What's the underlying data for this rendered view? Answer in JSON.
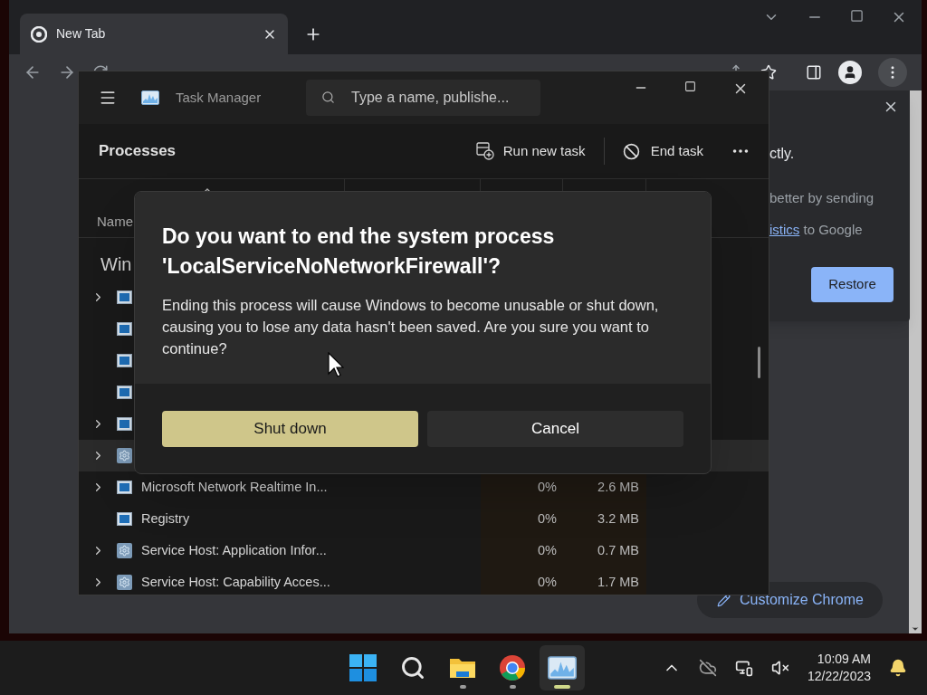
{
  "browser": {
    "tab": {
      "title": "New Tab"
    },
    "popup": {
      "line_1": "ctly.",
      "line_2": "better by sending",
      "link": "istics",
      "line_3_rest": " to Google",
      "restore_button": "Restore"
    },
    "customize_button": "Customize Chrome"
  },
  "task_manager": {
    "title": "Task Manager",
    "search": {
      "placeholder": "Type a name, publishe..."
    },
    "page_title": "Processes",
    "actions": [
      "Run new task",
      "End task"
    ],
    "columns": [
      {
        "label": "Name"
      }
    ],
    "group": "Win",
    "rows": [
      {
        "name": "",
        "expandable": true,
        "kind": "window",
        "selected": false,
        "cpu": "",
        "memory": ""
      },
      {
        "name": "",
        "expandable": false,
        "kind": "window",
        "selected": false,
        "cpu": "",
        "memory": ""
      },
      {
        "name": "",
        "expandable": false,
        "kind": "window",
        "selected": false,
        "cpu": "",
        "memory": ""
      },
      {
        "name": "",
        "expandable": false,
        "kind": "window",
        "selected": false,
        "cpu": "",
        "memory": ""
      },
      {
        "name": "",
        "expandable": true,
        "kind": "window",
        "selected": false,
        "cpu": "",
        "memory": ""
      },
      {
        "name": "",
        "expandable": true,
        "kind": "gear",
        "selected": true,
        "cpu": "",
        "memory": ""
      },
      {
        "name": "Microsoft Network Realtime In...",
        "expandable": true,
        "kind": "window",
        "selected": false,
        "cpu": "0%",
        "memory": "2.6 MB"
      },
      {
        "name": "Registry",
        "expandable": false,
        "kind": "window",
        "selected": false,
        "cpu": "0%",
        "memory": "3.2 MB"
      },
      {
        "name": "Service Host: Application Infor...",
        "expandable": true,
        "kind": "gear",
        "selected": false,
        "cpu": "0%",
        "memory": "0.7 MB"
      },
      {
        "name": "Service Host: Capability Acces...",
        "expandable": true,
        "kind": "gear",
        "selected": false,
        "cpu": "0%",
        "memory": "1.7 MB"
      }
    ]
  },
  "dialog": {
    "title": "Do you want to end the system process 'LocalServiceNoNetworkFirewall'?",
    "message": "Ending this process will cause Windows to become unusable or shut down, causing you to lose any data hasn't been saved. Are you sure you want to continue?",
    "confirm_button": "Shut down",
    "cancel_button": "Cancel"
  },
  "taskbar": {
    "apps": [
      {
        "kind": "folder",
        "running": true,
        "active": false
      },
      {
        "kind": "chrome",
        "running": true,
        "active": false
      },
      {
        "kind": "taskmgr",
        "running": true,
        "active": true
      }
    ],
    "time": "10:09 AM",
    "date": "12/22/2023"
  }
}
